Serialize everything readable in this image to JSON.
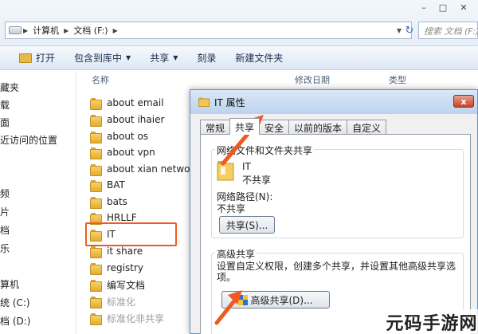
{
  "address_bar": {
    "crumbs": [
      "计算机",
      "文档 (F:)"
    ],
    "search_placeholder": "搜索 文档 (F:)"
  },
  "toolbar": {
    "open": "打开",
    "include_library": "包含到库中",
    "share": "共享",
    "burn": "刻录",
    "new_folder": "新建文件夹"
  },
  "nav_pane": {
    "items": [
      "藏夹",
      "载",
      "面",
      "近访问的位置",
      "频",
      "片",
      "档",
      "乐",
      "算机",
      "统 (C:)",
      "档 (D:)"
    ]
  },
  "columns": {
    "name": "名称",
    "modified": "修改日期",
    "type": "类型"
  },
  "files": [
    {
      "name": "about email"
    },
    {
      "name": "about ihaier"
    },
    {
      "name": "about os"
    },
    {
      "name": "about vpn"
    },
    {
      "name": "about xian networ"
    },
    {
      "name": "BAT"
    },
    {
      "name": "bats"
    },
    {
      "name": "HRLLF"
    },
    {
      "name": "IT"
    },
    {
      "name": "it share"
    },
    {
      "name": "registry"
    },
    {
      "name": "编写文档"
    },
    {
      "name": "标准化"
    },
    {
      "name": "标准化非共享"
    }
  ],
  "dialog": {
    "title": "IT 属性",
    "close_label": "x",
    "tabs": [
      "常规",
      "共享",
      "安全",
      "以前的版本",
      "自定义"
    ],
    "network_group": {
      "legend": "网络文件和文件夹共享",
      "folder_name": "IT",
      "status": "不共享",
      "path_label": "网络路径(N):",
      "path_value": "不共享",
      "share_button": "共享(S)..."
    },
    "advanced_group": {
      "legend": "高级共享",
      "description": "设置自定义权限，创建多个共享，并设置其他高级共享选项。",
      "button": "高级共享(D)..."
    }
  },
  "brand": {
    "text": "元码手游网"
  },
  "colors": {
    "highlight": "#f05a22",
    "arrow": "#f05a22",
    "folder": "#e8b84a"
  }
}
